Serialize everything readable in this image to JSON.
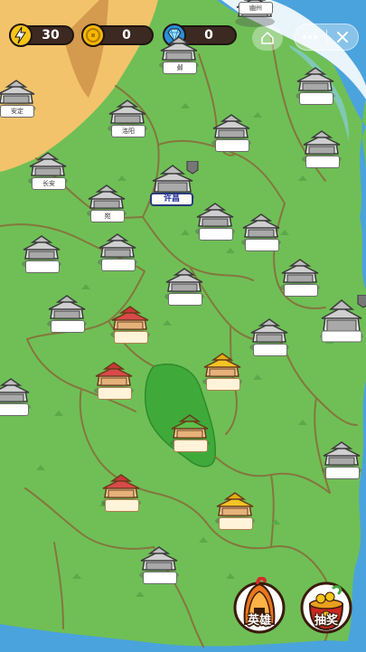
{
  "hud": {
    "energy": {
      "value": "30",
      "icon": "lightning-icon"
    },
    "coins": {
      "value": "0",
      "icon": "coin-icon"
    },
    "gems": {
      "value": "0",
      "icon": "diamond-icon"
    },
    "home_icon": "home-icon",
    "menu_icon": "more-icon",
    "close_icon": "close-icon"
  },
  "cities": {
    "youzhou": "幽州",
    "ye": "邺",
    "anding": "安定",
    "luoyang": "洛阳",
    "changan": "长安",
    "wan": "宛",
    "xuchang": "许昌"
  },
  "buttons": {
    "heroes": "英雄",
    "lottery": "抽奖"
  },
  "colors": {
    "grass": "#6fbf56",
    "desert": "#f2c36b",
    "sea": "#4aa3dd",
    "lake": "#3faa3a",
    "border": "#8a6a3a"
  }
}
